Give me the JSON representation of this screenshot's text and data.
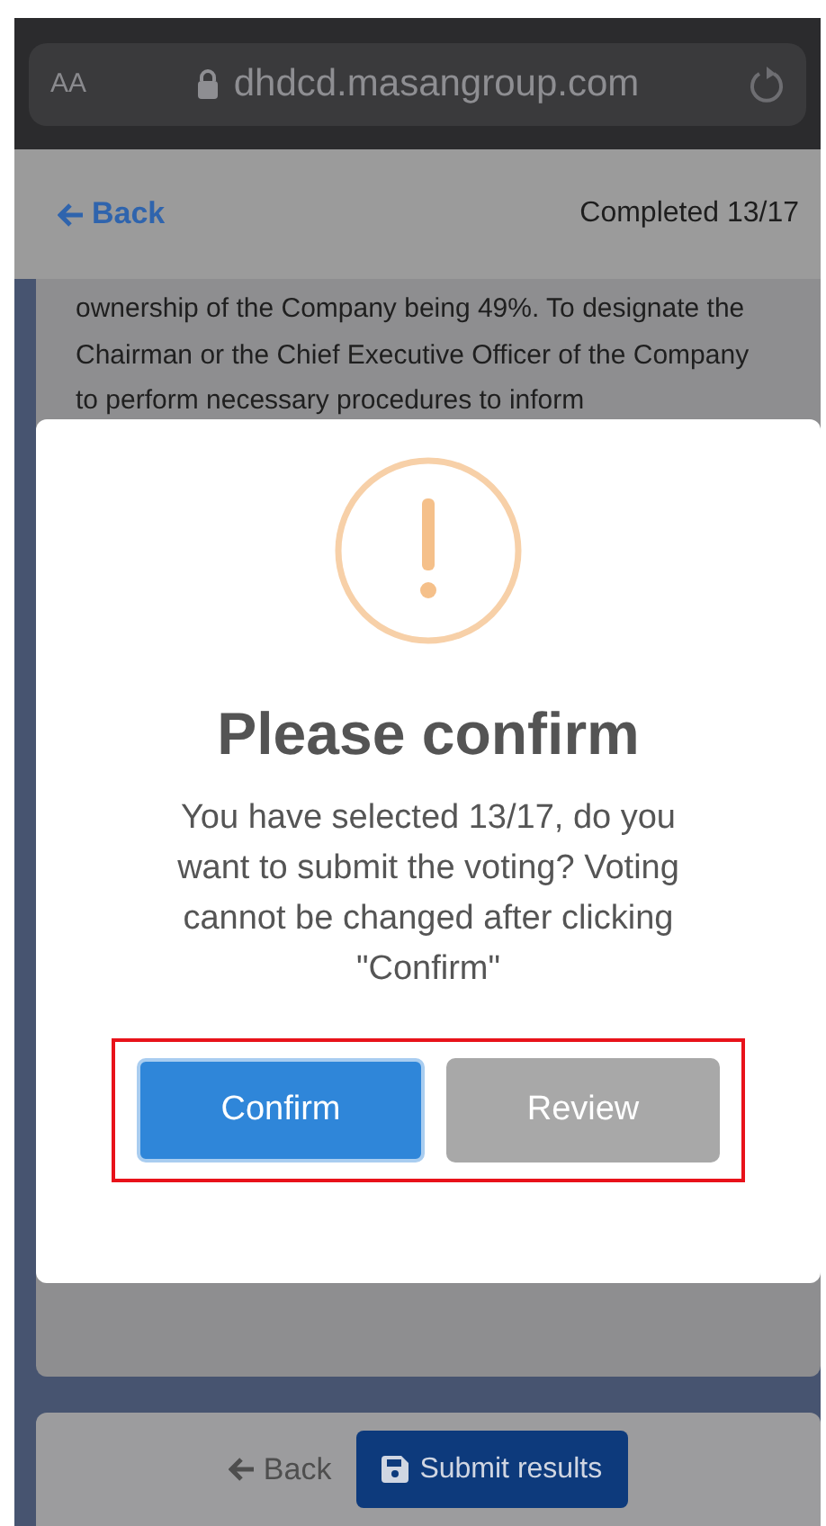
{
  "browser": {
    "text_size": "AA",
    "url": "dhdcd.masangroup.com"
  },
  "header": {
    "back": "Back",
    "progress": "Completed 13/17"
  },
  "content": {
    "paragraph": "ownership of the Company being 49%. To designate the Chairman or the Chief Executive Officer of the Company to perform necessary procedures to inform"
  },
  "dialog": {
    "title": "Please confirm",
    "message": "You have selected 13/17, do you want to submit the voting? Voting cannot be changed after clicking \"Confirm\"",
    "buttons": [
      {
        "label": "Confirm",
        "kind": "primary"
      },
      {
        "label": "Review",
        "kind": "secondary"
      }
    ],
    "highlighted": true
  },
  "footer": {
    "back": "Back",
    "submit": "Submit results"
  }
}
